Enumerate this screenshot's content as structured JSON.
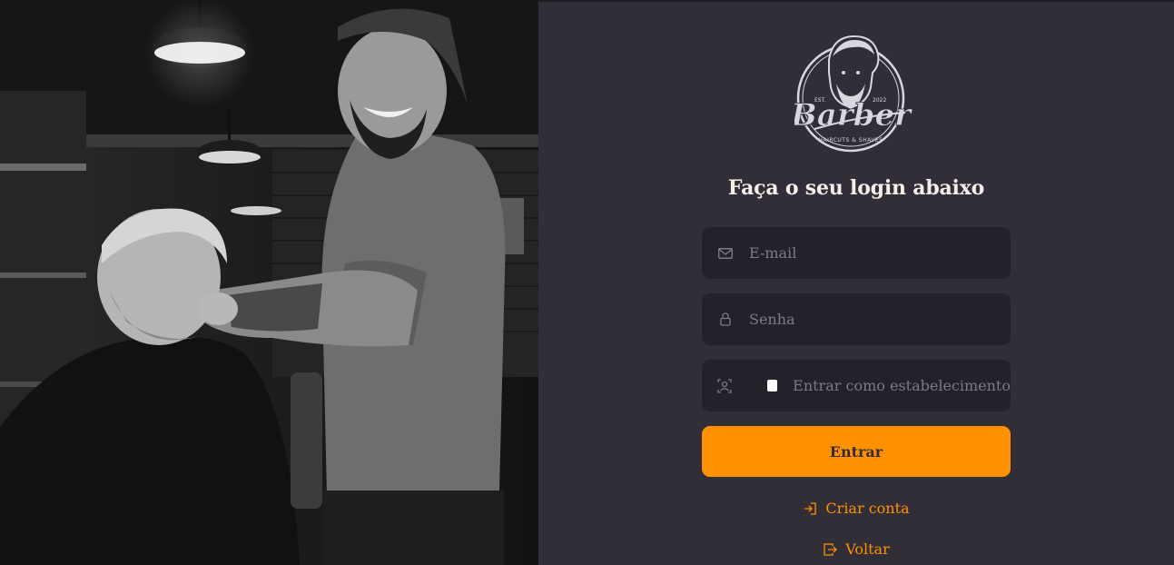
{
  "logo": {
    "brand": "Barber",
    "tagline": "HAIRCUTS & SHAVES",
    "est_left": "EST.",
    "est_right": "2022"
  },
  "title": "Faça o seu login abaixo",
  "form": {
    "email_placeholder": "E-mail",
    "password_placeholder": "Senha",
    "establishment_label": "Entrar como estabelecimento",
    "establishment_checked": false,
    "submit_label": "Entrar"
  },
  "links": {
    "create_account": "Criar conta",
    "back": "Voltar"
  },
  "colors": {
    "accent": "#ff9000",
    "panel_bg": "#312e38",
    "input_bg": "#232129",
    "text": "#f4ede8",
    "placeholder": "#7c7a82"
  }
}
